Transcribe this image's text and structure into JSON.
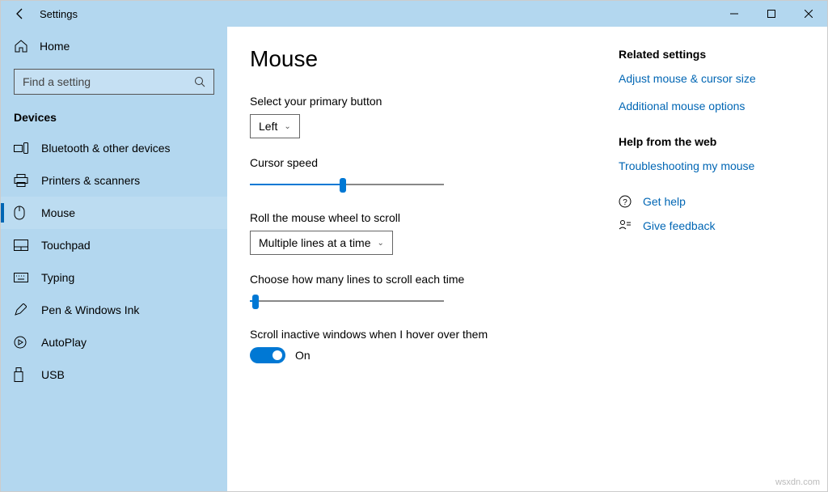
{
  "window": {
    "title": "Settings"
  },
  "sidebar": {
    "home_label": "Home",
    "search_placeholder": "Find a setting",
    "category_label": "Devices",
    "items": [
      {
        "label": "Bluetooth & other devices"
      },
      {
        "label": "Printers & scanners"
      },
      {
        "label": "Mouse"
      },
      {
        "label": "Touchpad"
      },
      {
        "label": "Typing"
      },
      {
        "label": "Pen & Windows Ink"
      },
      {
        "label": "AutoPlay"
      },
      {
        "label": "USB"
      }
    ]
  },
  "main": {
    "heading": "Mouse",
    "primary_button_label": "Select your primary button",
    "primary_button_value": "Left",
    "cursor_speed_label": "Cursor speed",
    "cursor_speed_value": 48,
    "wheel_scroll_label": "Roll the mouse wheel to scroll",
    "wheel_scroll_value": "Multiple lines at a time",
    "lines_each_time_label": "Choose how many lines to scroll each time",
    "lines_each_time_value": 3,
    "scroll_inactive_label": "Scroll inactive windows when I hover over them",
    "scroll_inactive_state": "On"
  },
  "related": {
    "heading": "Related settings",
    "links": [
      {
        "label": "Adjust mouse & cursor size"
      },
      {
        "label": "Additional mouse options"
      }
    ]
  },
  "helpweb": {
    "heading": "Help from the web",
    "links": [
      {
        "label": "Troubleshooting my mouse"
      }
    ]
  },
  "support": {
    "get_help": "Get help",
    "give_feedback": "Give feedback"
  },
  "watermark": "wsxdn.com",
  "colors": {
    "accent": "#0078d4",
    "link": "#0066b4",
    "sidebar_bg": "#b3d7ef"
  }
}
